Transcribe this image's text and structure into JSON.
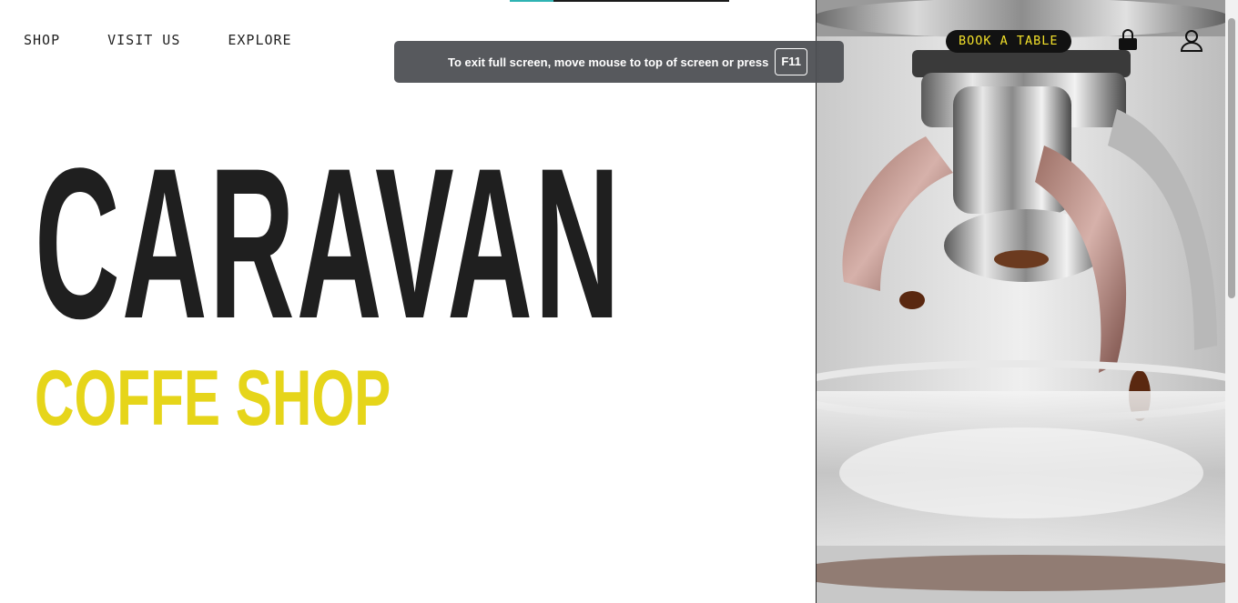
{
  "nav": {
    "items": [
      {
        "label": "SHOP"
      },
      {
        "label": "VISIT US"
      },
      {
        "label": "EXPLORE"
      }
    ]
  },
  "hero": {
    "title": "CARAVAN",
    "subtitle": "COFFE SHOP"
  },
  "header_actions": {
    "book_label": "BOOK A TABLE",
    "cart_icon": "shopping-bag-icon",
    "account_icon": "user-icon"
  },
  "fullscreen_notice": {
    "message": "To exit full screen, move mouse to top of screen or press",
    "key": "F11"
  },
  "progress": {
    "fraction": 0.2
  },
  "colors": {
    "text_dark": "#1f1f1f",
    "accent_yellow": "#e6d51a",
    "button_bg": "#121212",
    "button_text": "#f2e02a"
  }
}
